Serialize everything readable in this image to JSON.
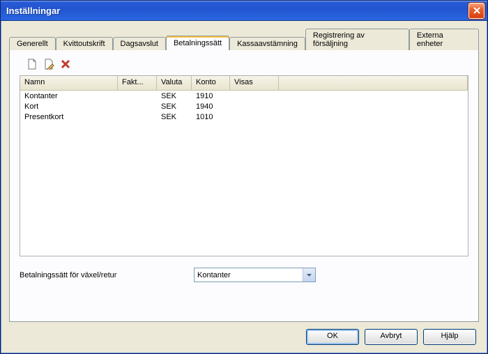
{
  "window": {
    "title": "Inställningar"
  },
  "tabs": [
    {
      "label": "Generellt"
    },
    {
      "label": "Kvittoutskrift"
    },
    {
      "label": "Dagsavslut"
    },
    {
      "label": "Betalningssätt"
    },
    {
      "label": "Kassaavstämning"
    },
    {
      "label": "Registrering av försäljning"
    },
    {
      "label": "Externa enheter"
    }
  ],
  "columns": {
    "namn": "Namn",
    "fakt": "Fakt...",
    "valuta": "Valuta",
    "konto": "Konto",
    "visas": "Visas"
  },
  "rows": [
    {
      "namn": "Kontanter",
      "fakt": "",
      "valuta": "SEK",
      "konto": "1910",
      "visas": ""
    },
    {
      "namn": "Kort",
      "fakt": "",
      "valuta": "SEK",
      "konto": "1940",
      "visas": ""
    },
    {
      "namn": "Presentkort",
      "fakt": "",
      "valuta": "SEK",
      "konto": "1010",
      "visas": ""
    }
  ],
  "comboLabel": "Betalningssätt för växel/retur",
  "comboValue": "Kontanter",
  "buttons": {
    "ok": "OK",
    "cancel": "Avbryt",
    "help": "Hjälp"
  }
}
